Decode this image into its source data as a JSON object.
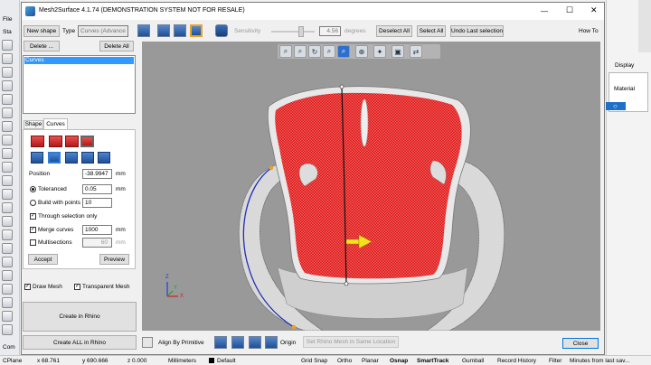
{
  "window": {
    "title": "Mesh2Surface 4.1.74 (DEMONSTRATION SYSTEM NOT FOR RESALE)",
    "min_glyph": "—",
    "max_glyph": "☐",
    "close_glyph": "✕"
  },
  "rhino": {
    "file_menu": "File",
    "left_tab": "Sta",
    "display_tab": "Display",
    "material_label": "Material",
    "command_label": "Com",
    "circle_glyph": "○"
  },
  "toolbar": {
    "new_shape": "New shape",
    "type_label": "Type",
    "type_value": "Curves (Advance",
    "sensitivity_label": "Sensitivity",
    "sensitivity_value": "4.56",
    "degrees_label": "degrees",
    "deselect_all": "Deselect All",
    "select_all": "Select All",
    "undo_last": "Undo Last selection",
    "how_to": "How To"
  },
  "shape_panel": {
    "delete": "Delete ...",
    "delete_all": "Delete All",
    "list_items": [
      "Curves"
    ]
  },
  "tabs": {
    "shape": "Shape",
    "curves": "Curves"
  },
  "curves": {
    "position_label": "Position",
    "position_value": "-38.9947",
    "position_unit": "mm",
    "toleranced_label": "Toleranced",
    "toleranced_value": "0.05",
    "toleranced_unit": "mm",
    "build_points_label": "Build with points",
    "build_points_value": "10",
    "through_selection_label": "Through selection only",
    "merge_curves_label": "Merge curves",
    "merge_curves_value": "1000",
    "merge_curves_unit": "mm",
    "multisections_label": "Multisections",
    "multisections_value": "60",
    "multisections_unit": "mm",
    "accept": "Accept",
    "preview": "Preview",
    "check_glyph": "✓"
  },
  "draw": {
    "draw_mesh": "Draw Mesh",
    "transparent_mesh": "Transparent Mesh"
  },
  "actions": {
    "create_in_rhino": "Create in Rhino",
    "create_all_in_rhino": "Create ALL in Rhino"
  },
  "bottom": {
    "align_by_primitive": "Align By Primitive",
    "origin": "Origin",
    "set_rhino_mesh": "Set Rhino Mesh in Same Location",
    "close": "Close"
  },
  "viewport_tools": [
    "⌕",
    "⌕",
    "↻",
    "⌕",
    "⌕",
    "⊕",
    "✦",
    "▣",
    "⇄"
  ],
  "axis": {
    "x": "X",
    "y": "Y",
    "z": "Z"
  },
  "status": {
    "cplane": "CPlane",
    "x": "x 68.761",
    "y": "y 690.666",
    "z": "z 0.000",
    "units": "Millimeters",
    "layer": "Default",
    "grid_snap": "Grid Snap",
    "ortho": "Ortho",
    "planar": "Planar",
    "osnap": "Osnap",
    "smarttrack": "SmartTrack",
    "gumball": "Gumball",
    "record_history": "Record History",
    "filter": "Filter",
    "last_save": "Minutes from last sav..."
  },
  "colors": {
    "mesh_red": "#e22020",
    "accent_blue": "#1f4f96",
    "selection": "#3399ff"
  }
}
